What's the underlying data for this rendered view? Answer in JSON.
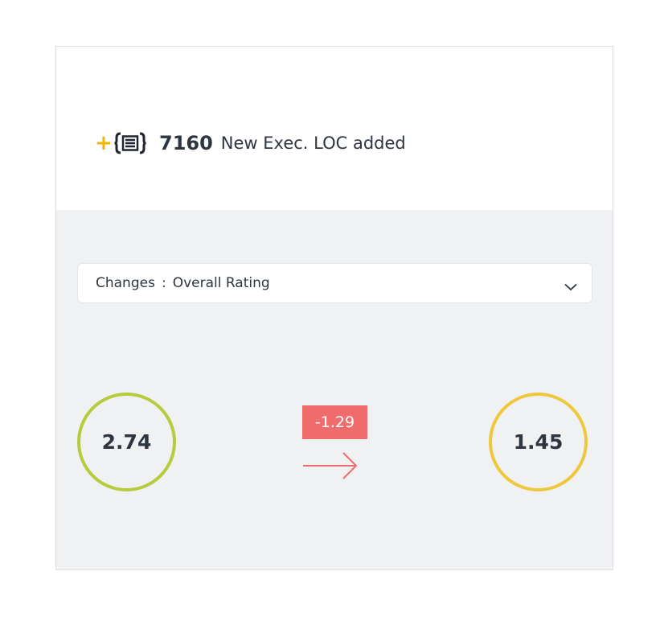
{
  "summary": {
    "loc_count": "7160",
    "loc_text": "New Exec. LOC added",
    "plus_icon": "plus-icon",
    "code_icon": "code-braces-icon"
  },
  "dropdown": {
    "label": "Changes",
    "separator": ":",
    "value": "Overall Rating",
    "icon": "chevron-down-icon"
  },
  "rating": {
    "before": "2.74",
    "after": "1.45",
    "delta": "-1.29",
    "colors": {
      "before_ring": "#b5cc3c",
      "after_ring": "#eec83c",
      "delta_bg": "#f16c6c",
      "arrow": "#f16c6c",
      "accent_plus": "#f2b400"
    }
  }
}
